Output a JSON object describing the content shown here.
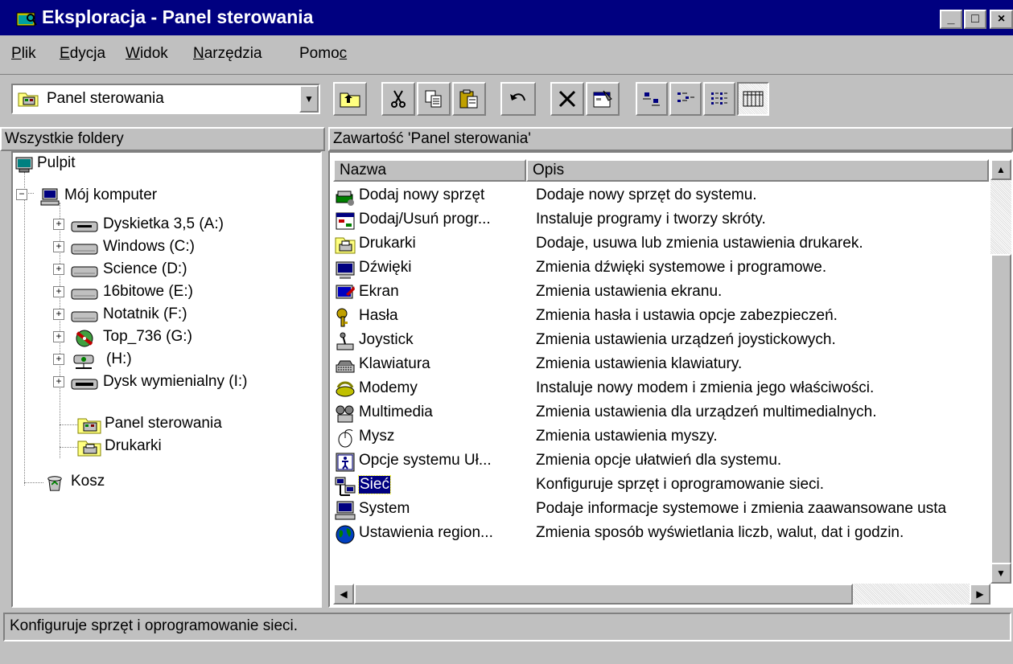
{
  "window": {
    "title": "Eksploracja - Panel sterowania",
    "buttons": [
      "_",
      "□",
      "×"
    ]
  },
  "menu": [
    {
      "label": "Plik",
      "accel": "P"
    },
    {
      "label": "Edycja",
      "accel": "E"
    },
    {
      "label": "Widok",
      "accel": "W"
    },
    {
      "label": "Narzędzia",
      "accel": "N"
    },
    {
      "label": "Pomoc",
      "accel": "c"
    }
  ],
  "address": {
    "value": "Panel sterowania",
    "icon": "control-panel-icon"
  },
  "toolbar": {
    "buttons": [
      "up-folder-icon",
      "cut-icon",
      "copy-icon",
      "paste-icon",
      "undo-icon",
      "delete-icon",
      "properties-icon",
      "large-icons-icon",
      "small-icons-icon",
      "list-icon",
      "details-icon"
    ]
  },
  "tree": {
    "header": "Wszystkie foldery",
    "nodes": [
      {
        "label": "Pulpit",
        "icon": "desktop-icon"
      },
      {
        "label": "Mój komputer",
        "icon": "computer-icon"
      },
      {
        "label": "Dyskietka 3,5 (A:)",
        "icon": "floppy-icon"
      },
      {
        "label": "Windows (C:)",
        "icon": "drive-icon"
      },
      {
        "label": "Science (D:)",
        "icon": "drive-icon"
      },
      {
        "label": "16bitowe (E:)",
        "icon": "drive-icon"
      },
      {
        "label": "Notatnik (F:)",
        "icon": "drive-icon"
      },
      {
        "label": "Top_736 (G:)",
        "icon": "cdrom-icon"
      },
      {
        "label": "(H:)",
        "icon": "network-drive-icon"
      },
      {
        "label": "Dysk wymienialny (I:)",
        "icon": "removable-drive-icon"
      },
      {
        "label": "Panel sterowania",
        "icon": "control-panel-folder-icon"
      },
      {
        "label": "Drukarki",
        "icon": "printers-folder-icon"
      },
      {
        "label": "Kosz",
        "icon": "recycle-bin-icon"
      }
    ]
  },
  "content": {
    "header": "Zawartość 'Panel sterowania'",
    "columns": [
      "Nazwa",
      "Opis"
    ],
    "rows": [
      {
        "name": "Dodaj nowy sprzęt",
        "desc": "Dodaje nowy sprzęt do systemu.",
        "icon": "add-hardware-icon"
      },
      {
        "name": "Dodaj/Usuń progr...",
        "desc": "Instaluje programy i tworzy skróty.",
        "icon": "add-remove-programs-icon"
      },
      {
        "name": "Drukarki",
        "desc": "Dodaje, usuwa lub zmienia ustawienia drukarek.",
        "icon": "printers-icon"
      },
      {
        "name": "Dźwięki",
        "desc": "Zmienia dźwięki systemowe i programowe.",
        "icon": "sounds-icon"
      },
      {
        "name": "Ekran",
        "desc": "Zmienia ustawienia ekranu.",
        "icon": "display-icon"
      },
      {
        "name": "Hasła",
        "desc": "Zmienia hasła i ustawia opcje zabezpieczeń.",
        "icon": "passwords-icon"
      },
      {
        "name": "Joystick",
        "desc": "Zmienia ustawienia urządzeń joystickowych.",
        "icon": "joystick-icon"
      },
      {
        "name": "Klawiatura",
        "desc": "Zmienia ustawienia klawiatury.",
        "icon": "keyboard-icon"
      },
      {
        "name": "Modemy",
        "desc": "Instaluje nowy modem i zmienia jego właściwości.",
        "icon": "modems-icon"
      },
      {
        "name": "Multimedia",
        "desc": "Zmienia ustawienia dla urządzeń multimedialnych.",
        "icon": "multimedia-icon"
      },
      {
        "name": "Mysz",
        "desc": "Zmienia ustawienia myszy.",
        "icon": "mouse-icon"
      },
      {
        "name": "Opcje systemu Uł...",
        "desc": "Zmienia opcje ułatwień dla systemu.",
        "icon": "accessibility-icon"
      },
      {
        "name": "Sieć",
        "desc": "Konfiguruje sprzęt i oprogramowanie sieci.",
        "icon": "network-icon",
        "selected": true
      },
      {
        "name": "System",
        "desc": "Podaje informacje systemowe i zmienia zaawansowane usta",
        "icon": "system-icon"
      },
      {
        "name": "Ustawienia region...",
        "desc": "Zmienia sposób wyświetlania liczb, walut, dat i godzin.",
        "icon": "regional-settings-icon"
      }
    ]
  },
  "status": {
    "text": "Konfiguruje sprzęt i oprogramowanie sieci."
  }
}
